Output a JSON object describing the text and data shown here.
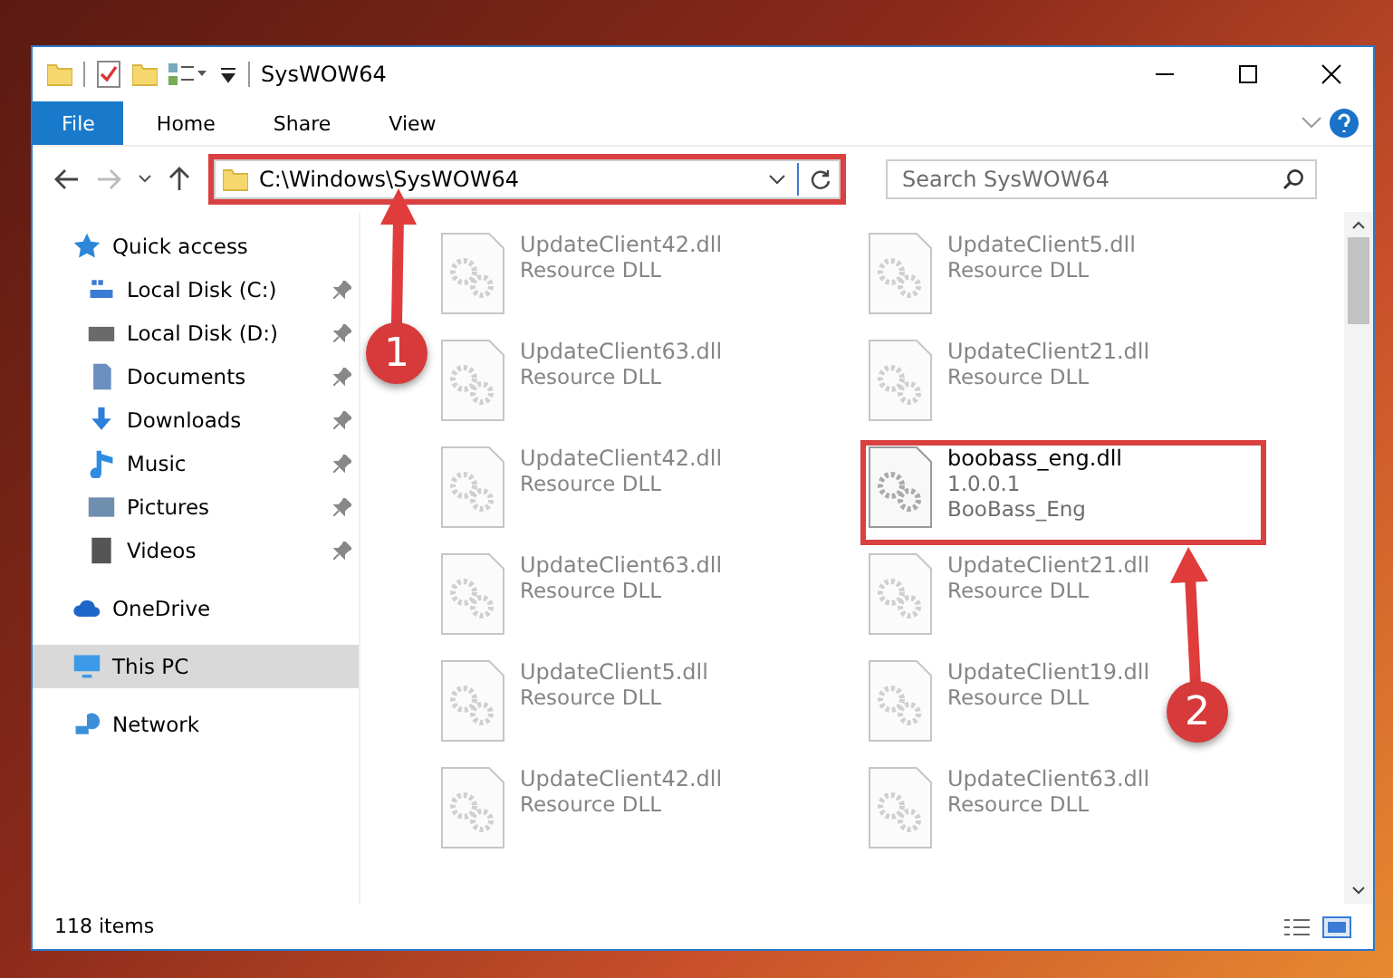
{
  "window": {
    "title": "SysWOW64"
  },
  "ribbon_tabs": [
    {
      "label": "File",
      "selected": true
    },
    {
      "label": "Home",
      "selected": false
    },
    {
      "label": "Share",
      "selected": false
    },
    {
      "label": "View",
      "selected": false
    }
  ],
  "address": {
    "path": "C:\\Windows\\SysWOW64",
    "highlighted": true
  },
  "search": {
    "placeholder": "Search SysWOW64"
  },
  "sidebar": {
    "items": [
      {
        "label": "Quick access",
        "kind": "star",
        "selected": false,
        "children": [
          {
            "label": "Local Disk (C:)",
            "kind": "system-drive",
            "pinned": true,
            "selected": false
          },
          {
            "label": "Local Disk (D:)",
            "kind": "drive",
            "pinned": true,
            "selected": false
          },
          {
            "label": "Documents",
            "kind": "documents",
            "pinned": true,
            "selected": false
          },
          {
            "label": "Downloads",
            "kind": "downloads",
            "pinned": true,
            "selected": false
          },
          {
            "label": "Music",
            "kind": "music",
            "pinned": true,
            "selected": false
          },
          {
            "label": "Pictures",
            "kind": "pictures",
            "pinned": true,
            "selected": false
          },
          {
            "label": "Videos",
            "kind": "videos",
            "pinned": true,
            "selected": false
          }
        ]
      },
      {
        "label": "OneDrive",
        "kind": "cloud",
        "selected": false
      },
      {
        "label": "This PC",
        "kind": "pc",
        "selected": true
      },
      {
        "label": "Network",
        "kind": "network",
        "selected": false
      }
    ]
  },
  "files": [
    {
      "name": "UpdateClient42.dll",
      "lines": [
        "Resource DLL"
      ],
      "highlighted": false
    },
    {
      "name": "UpdateClient5.dll",
      "lines": [
        "Resource DLL"
      ],
      "highlighted": false
    },
    {
      "name": "UpdateClient63.dll",
      "lines": [
        "Resource DLL"
      ],
      "highlighted": false
    },
    {
      "name": "UpdateClient21.dll",
      "lines": [
        "Resource DLL"
      ],
      "highlighted": false
    },
    {
      "name": "UpdateClient42.dll",
      "lines": [
        "Resource DLL"
      ],
      "highlighted": false
    },
    {
      "name": "boobass_eng.dll",
      "lines": [
        "1.0.0.1",
        "BooBass_Eng"
      ],
      "highlighted": true
    },
    {
      "name": "UpdateClient63.dll",
      "lines": [
        "Resource DLL"
      ],
      "highlighted": false
    },
    {
      "name": "UpdateClient21.dll",
      "lines": [
        "Resource DLL"
      ],
      "highlighted": false
    },
    {
      "name": "UpdateClient5.dll",
      "lines": [
        "Resource DLL"
      ],
      "highlighted": false
    },
    {
      "name": "UpdateClient19.dll",
      "lines": [
        "Resource DLL"
      ],
      "highlighted": false
    },
    {
      "name": "UpdateClient42.dll",
      "lines": [
        "Resource DLL"
      ],
      "highlighted": false
    },
    {
      "name": "UpdateClient63.dll",
      "lines": [
        "Resource DLL"
      ],
      "highlighted": false
    }
  ],
  "status_bar": {
    "items_count": "118 items"
  },
  "annotations": [
    {
      "label": "1"
    },
    {
      "label": "2"
    }
  ]
}
